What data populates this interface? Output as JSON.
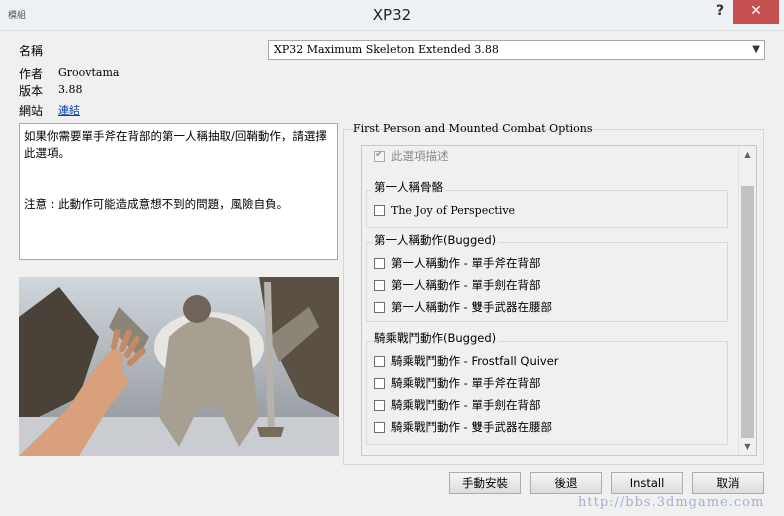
{
  "window": {
    "title": "XP32",
    "icon_text": "模組",
    "help_label": "?",
    "close_label": "✕"
  },
  "info": {
    "name_label": "名稱",
    "author_label": "作者",
    "author_value": "Groovtama",
    "version_label": "版本",
    "version_value": "3.88",
    "website_label": "網站",
    "website_link": "連結"
  },
  "package_select": {
    "selected": "XP32 Maximum Skeleton Extended 3.88"
  },
  "description": {
    "line1": "如果你需要單手斧在背部的第一人稱抽取/回鞘動作，請選擇此選項。",
    "line2": "注意 : 此動作可能造成意想不到的問題，風險自負。"
  },
  "options_group": {
    "caption": "First Person and Mounted Combat Options",
    "description_option": {
      "label": "此選項描述",
      "checked": true
    },
    "groups": [
      {
        "caption": "第一人稱骨骼",
        "items": [
          {
            "label": "The Joy of Perspective",
            "checked": false
          }
        ]
      },
      {
        "caption": "第一人稱動作(Bugged)",
        "items": [
          {
            "label": "第一人稱動作 - 單手斧在背部",
            "checked": false
          },
          {
            "label": "第一人稱動作 - 單手劍在背部",
            "checked": false
          },
          {
            "label": "第一人稱動作 - 雙手武器在腰部",
            "checked": false
          }
        ]
      },
      {
        "caption": "騎乘戰鬥動作(Bugged)",
        "items": [
          {
            "label": "騎乘戰鬥動作 - Frostfall Quiver",
            "checked": false
          },
          {
            "label": "騎乘戰鬥動作 - 單手斧在背部",
            "checked": false
          },
          {
            "label": "騎乘戰鬥動作 - 單手劍在背部",
            "checked": false
          },
          {
            "label": "騎乘戰鬥動作 - 雙手武器在腰部",
            "checked": false
          }
        ]
      }
    ]
  },
  "buttons": {
    "manual_install": "手動安裝",
    "back": "後退",
    "install": "Install",
    "cancel": "取消"
  },
  "watermark": "http://bbs.3dmgame.com",
  "colors": {
    "close_button": "#c75050",
    "link": "#0645ad"
  }
}
